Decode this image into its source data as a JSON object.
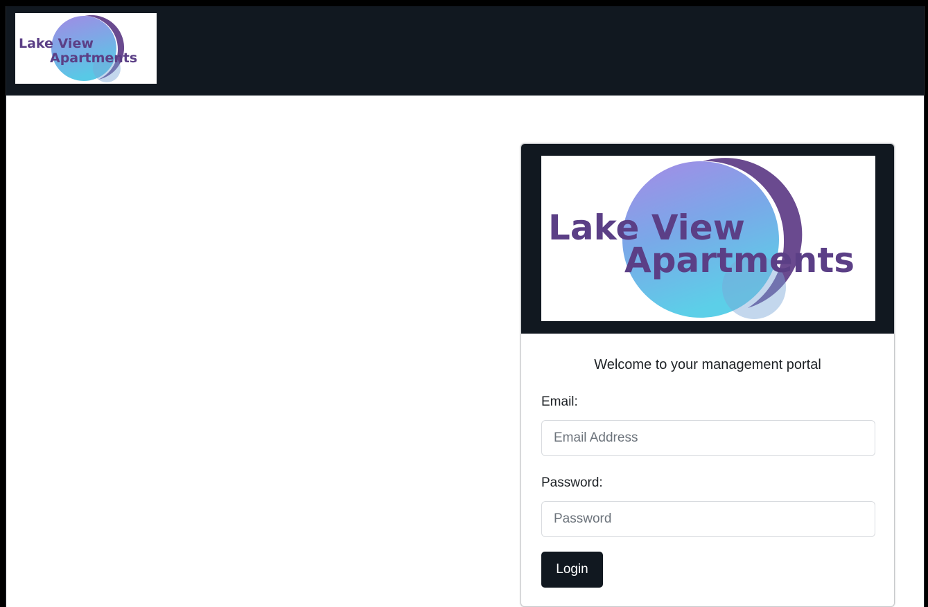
{
  "brand": {
    "line1": "Lake View",
    "line2": "Apartments",
    "text_color": "#5b3f86",
    "circle_light": "#9b84e0",
    "circle_mid": "#6fa8e4",
    "circle_cyan": "#5fd0e8",
    "crescent": "#6a4a8f"
  },
  "login_card": {
    "welcome": "Welcome to your management portal",
    "email_label": "Email:",
    "email_placeholder": "Email Address",
    "email_value": "",
    "password_label": "Password:",
    "password_placeholder": "Password",
    "password_value": "",
    "login_label": "Login"
  },
  "theme": {
    "navbar_bg": "#111820",
    "button_bg": "#111820",
    "page_bg": "#ffffff"
  }
}
